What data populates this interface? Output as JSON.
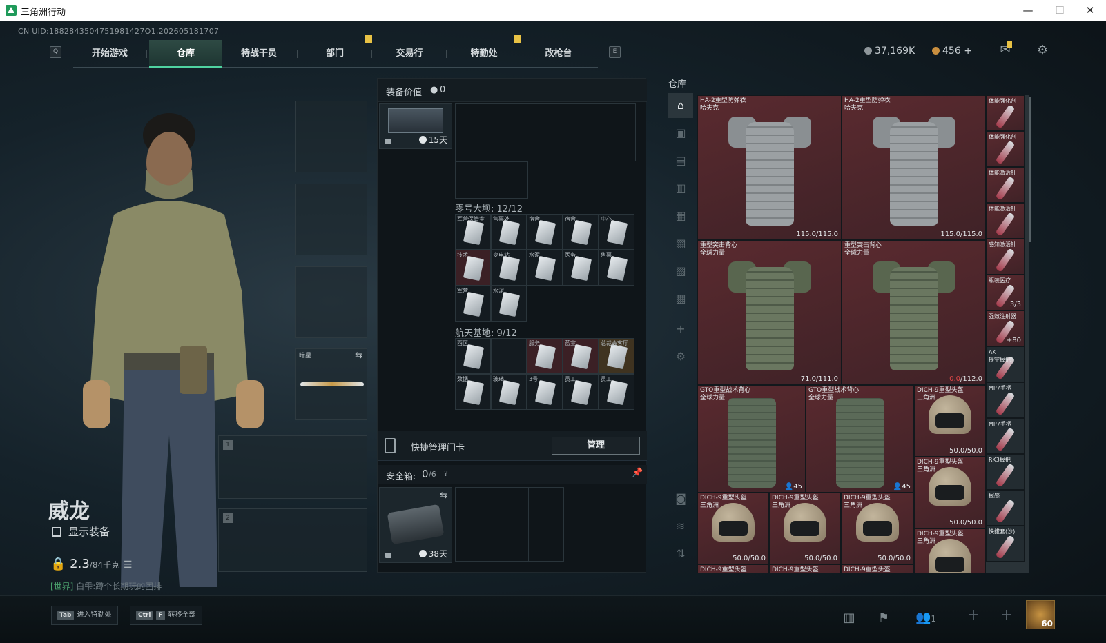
{
  "window": {
    "title": "三角洲行动",
    "minimize": "—",
    "maximize": "☐",
    "close": "✕"
  },
  "uid": "CN UID:1882843504751981427O1,202605181707",
  "nav": {
    "left_key": "Q",
    "right_key": "E",
    "tabs": [
      "开始游戏",
      "仓库",
      "特战干员",
      "部门",
      "交易行",
      "特勤处",
      "改枪台"
    ],
    "active": "仓库"
  },
  "currency": {
    "silver": "37,169K",
    "gold": "456",
    "gold_add": "+"
  },
  "character": {
    "name": "威龙",
    "show_equipment": "显示装备",
    "weight": "2.3",
    "weight_max": "/84千克",
    "chat_channel": "[世界]",
    "chat_user": "白雫",
    "chat_msg": ":蹲个长期玩的固排"
  },
  "equip_slots": {
    "melee_label": "暗星",
    "weapon1": "1",
    "weapon2": "2"
  },
  "middle": {
    "header": "装备价值",
    "value": "0",
    "top_timer": "15天",
    "group1": "零号大坝: 12/12",
    "group1_cards": [
      "军营保管室",
      "售票处",
      "宿舍",
      "宿舍",
      "中心",
      "技术",
      "变电站",
      "水泥",
      "医务",
      "售票",
      "军营",
      "水泥"
    ],
    "group2": "航天基地: 9/12",
    "group2_cards": [
      "西区",
      "",
      "服务",
      "蓝室",
      "总裁会客厅",
      "数据",
      "玻璃",
      "3号",
      "员工",
      "员工"
    ],
    "manage_label": "快捷管理门卡",
    "manage_btn": "管理",
    "safe_label": "安全箱:",
    "safe_count": "0",
    "safe_max": "/6",
    "safe_help": "?",
    "safe_timer": "38天"
  },
  "storage": {
    "title": "仓库",
    "items": {
      "ha_name": "HA-2重型防弹衣\n哈夫克",
      "ha_dur": "115.0/115.0",
      "assault_name": "重型突击背心\n全球力量",
      "assault_dur1": "71.0/111.0",
      "assault_dur2_bad": "0.0",
      "assault_dur2_max": "/112.0",
      "gto_name": "GTO重型战术背心\n全球力量",
      "gto_count": "45",
      "dich_name": "DICH-9重型头盔\n三角洲",
      "dich_dur": "50.0/50.0",
      "side_names": [
        "体能强化剂",
        "体能强化剂",
        "体能激活针",
        "体能激活针",
        "感知激活针",
        "瓶装医疗",
        "强效注射器",
        "AK\n提空握把",
        "MP7手柄",
        "MP7手柄",
        "RK3握把",
        "握感",
        "快拔套(沙)"
      ],
      "side_count1": "3/3",
      "side_count2": "+80"
    }
  },
  "bottom": {
    "hint1_key": "Tab",
    "hint1": "进入特勤处",
    "hint2_key": "Ctrl",
    "hint2_key2": "F",
    "hint2": "转移全部",
    "friends": "1",
    "level": "60"
  }
}
